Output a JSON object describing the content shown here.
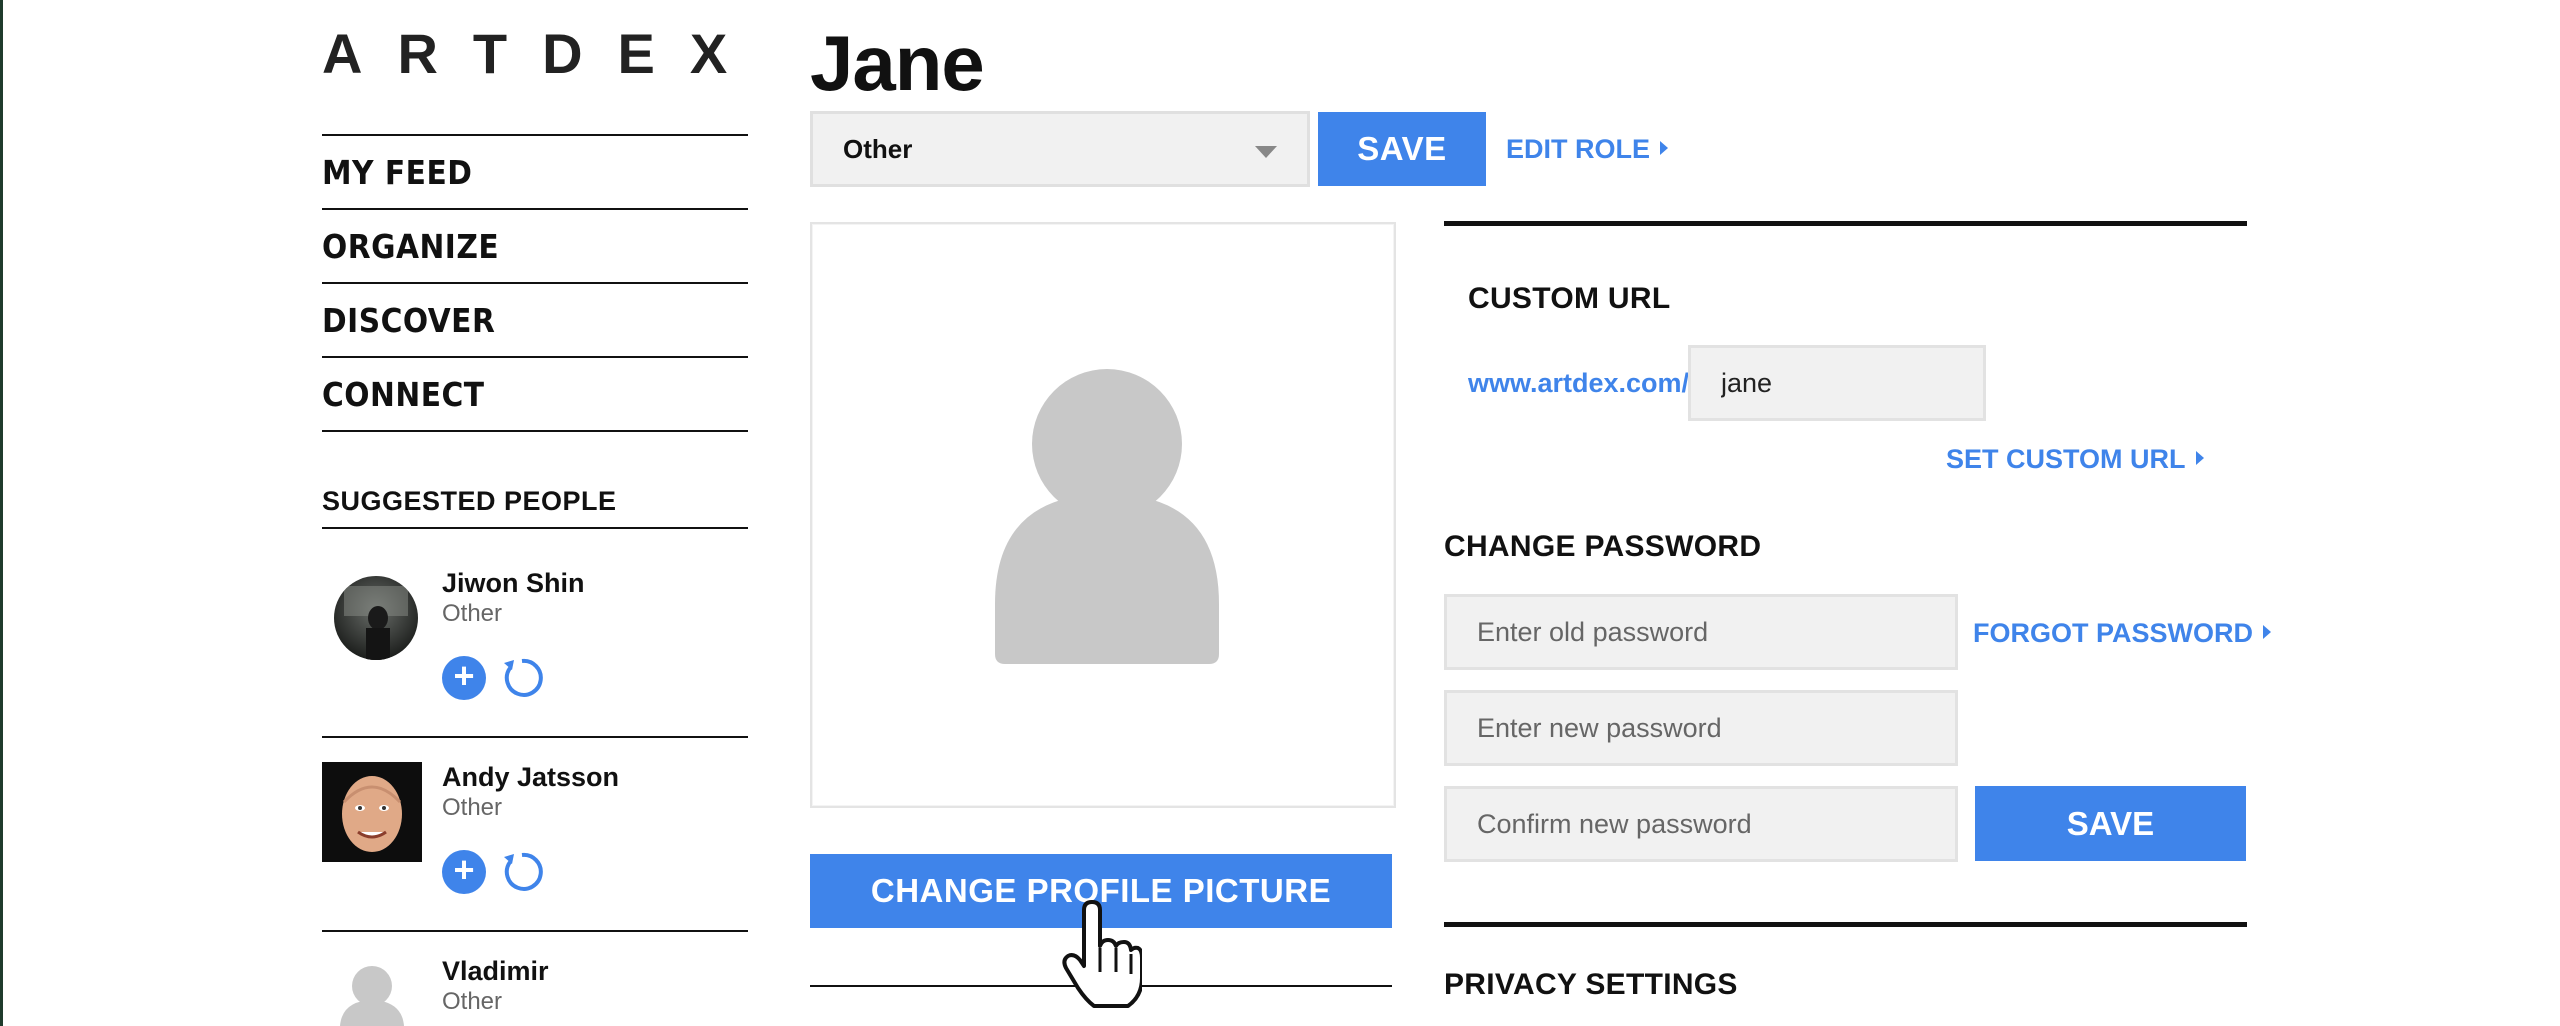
{
  "brand": {
    "logo": "ARTDEX"
  },
  "nav": {
    "items": [
      {
        "label": "MY FEED"
      },
      {
        "label": "ORGANIZE"
      },
      {
        "label": "DISCOVER"
      },
      {
        "label": "CONNECT"
      }
    ]
  },
  "suggested": {
    "title": "SUGGESTED PEOPLE",
    "people": [
      {
        "name": "Jiwon Shin",
        "role": "Other",
        "add_icon": "plus-circle-icon",
        "skip_icon": "refresh-icon"
      },
      {
        "name": "Andy Jatsson",
        "role": "Other",
        "add_icon": "plus-circle-icon",
        "skip_icon": "refresh-icon"
      },
      {
        "name": "Vladimir",
        "role": "Other"
      }
    ]
  },
  "profile": {
    "name": "Jane",
    "role_select": {
      "selected": "Other"
    },
    "save_label": "SAVE",
    "edit_role_label": "EDIT ROLE",
    "change_picture_label": "CHANGE PROFILE PICTURE"
  },
  "custom_url": {
    "title": "CUSTOM URL",
    "prefix": "www.artdex.com/",
    "value": "jane",
    "set_label": "SET CUSTOM URL"
  },
  "password": {
    "title": "CHANGE PASSWORD",
    "old_placeholder": "Enter old password",
    "new_placeholder": "Enter new password",
    "confirm_placeholder": "Confirm new password",
    "forgot_label": "FORGOT PASSWORD",
    "save_label": "SAVE"
  },
  "privacy": {
    "title": "PRIVACY SETTINGS"
  },
  "colors": {
    "accent": "#3f84ea",
    "text": "#111111",
    "field_bg": "#f1f1f1"
  }
}
